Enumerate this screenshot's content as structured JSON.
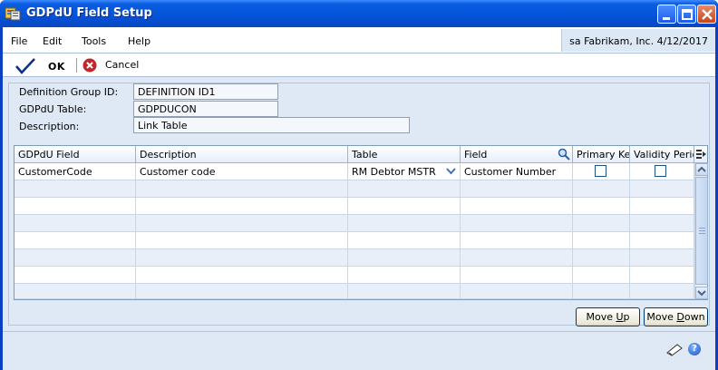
{
  "window": {
    "title": "GDPdU Field Setup"
  },
  "menu": {
    "file": "File",
    "edit": "Edit",
    "tools": "Tools",
    "help": "Help"
  },
  "user_info": "sa  Fabrikam, Inc.  4/12/2017",
  "toolbar": {
    "ok_label": "OK",
    "cancel_label": "Cancel"
  },
  "form": {
    "definition_group_label": "Definition Group ID:",
    "definition_group_value": "DEFINITION ID1",
    "table_label": "GDPdU Table:",
    "table_value": "GDPDUCON",
    "description_label": "Description:",
    "description_value": "Link Table"
  },
  "grid": {
    "columns": [
      "GDPdU Field",
      "Description",
      "Table",
      "Field",
      "Primary Key",
      "Validity Period"
    ],
    "rows": [
      {
        "gdpdu_field": "CustomerCode",
        "description": "Customer code",
        "table": "RM Debtor MSTR",
        "field": "Customer Number",
        "primary_key": false,
        "validity_period": false
      }
    ]
  },
  "buttons": {
    "move_up_pre": "Move ",
    "move_up_key": "U",
    "move_up_post": "p",
    "move_down_pre": "Move ",
    "move_down_key": "D",
    "move_down_post": "own"
  },
  "colors": {
    "titlebar": "#0553d8",
    "client": "#dfe9f5",
    "row_alt": "#e8eff8"
  }
}
